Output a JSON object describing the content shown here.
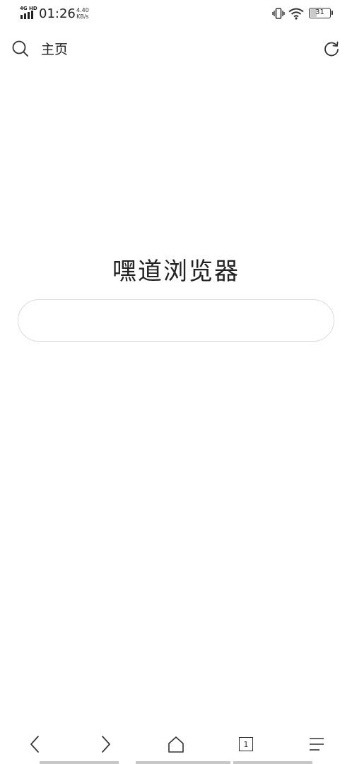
{
  "status_bar": {
    "network": "4G HD",
    "time": "01:26",
    "speed_value": "4.40",
    "speed_unit": "KB/s",
    "battery_level": "31",
    "battery_fraction": 0.31,
    "icons": [
      "signal-icon",
      "vibrate-icon",
      "wifi-icon",
      "battery-icon"
    ]
  },
  "header": {
    "title": "主页",
    "left_icon": "search-icon",
    "right_icon": "refresh-icon"
  },
  "main": {
    "brand_title": "嘿道浏览器",
    "search_value": ""
  },
  "toolbar": {
    "items": [
      "back-icon",
      "forward-icon",
      "home-icon",
      "tabs-icon",
      "menu-icon"
    ],
    "tab_count": "1"
  },
  "colors": {
    "background": "#ffffff",
    "text": "#222222",
    "border": "#dcdcdc",
    "icon": "#333333"
  }
}
